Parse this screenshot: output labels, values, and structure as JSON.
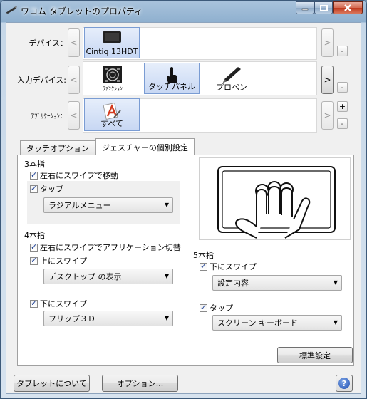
{
  "window": {
    "title": "ワコム タブレットのプロパティ"
  },
  "rows": {
    "device": {
      "label": "デバイス：",
      "items": [
        {
          "label": "Cintiq 13HDT",
          "icon": "tablet-icon",
          "selected": true
        }
      ]
    },
    "input_device": {
      "label": "入力デバイス:",
      "items": [
        {
          "label": "ﾌｧﾝｸｼｮﾝ",
          "icon": "function-keys-icon",
          "selected": false
        },
        {
          "label": "タッチパネル",
          "icon": "touch-hand-icon",
          "selected": true
        },
        {
          "label": "プロペン",
          "icon": "pen-icon",
          "selected": false
        }
      ]
    },
    "application": {
      "label": "ｱﾌﾟﾘｹｰｼｮﾝ：",
      "items": [
        {
          "label": "すべて",
          "icon": "all-apps-icon",
          "selected": true
        }
      ]
    }
  },
  "nav": {
    "prev": "<",
    "next": ">",
    "plus": "+",
    "minus": "-"
  },
  "tabs": [
    {
      "label": "タッチオプション",
      "active": false
    },
    {
      "label": "ジェスチャーの個別設定",
      "active": true
    }
  ],
  "gestures": {
    "three_finger": {
      "title": "3本指",
      "swipe_lr": {
        "label": "左右にスワイプで移動",
        "checked": true
      },
      "tap": {
        "label": "タップ",
        "checked": true,
        "value": "ラジアルメニュー"
      }
    },
    "four_finger": {
      "title": "4本指",
      "swipe_lr": {
        "label": "左右にスワイプでアプリケーション切替",
        "checked": true
      },
      "swipe_up": {
        "label": "上にスワイプ",
        "checked": true,
        "value": "デスクトップ の表示"
      },
      "swipe_down": {
        "label": "下にスワイプ",
        "checked": true,
        "value": "フリップ３Ｄ"
      }
    },
    "five_finger": {
      "title": "5本指",
      "swipe_down": {
        "label": "下にスワイプ",
        "checked": true,
        "value": "設定内容"
      },
      "tap": {
        "label": "タップ",
        "checked": true,
        "value": "スクリーン キーボード"
      }
    }
  },
  "buttons": {
    "default": "標準設定",
    "about": "タブレットについて",
    "options": "オプション..."
  },
  "help": "?"
}
